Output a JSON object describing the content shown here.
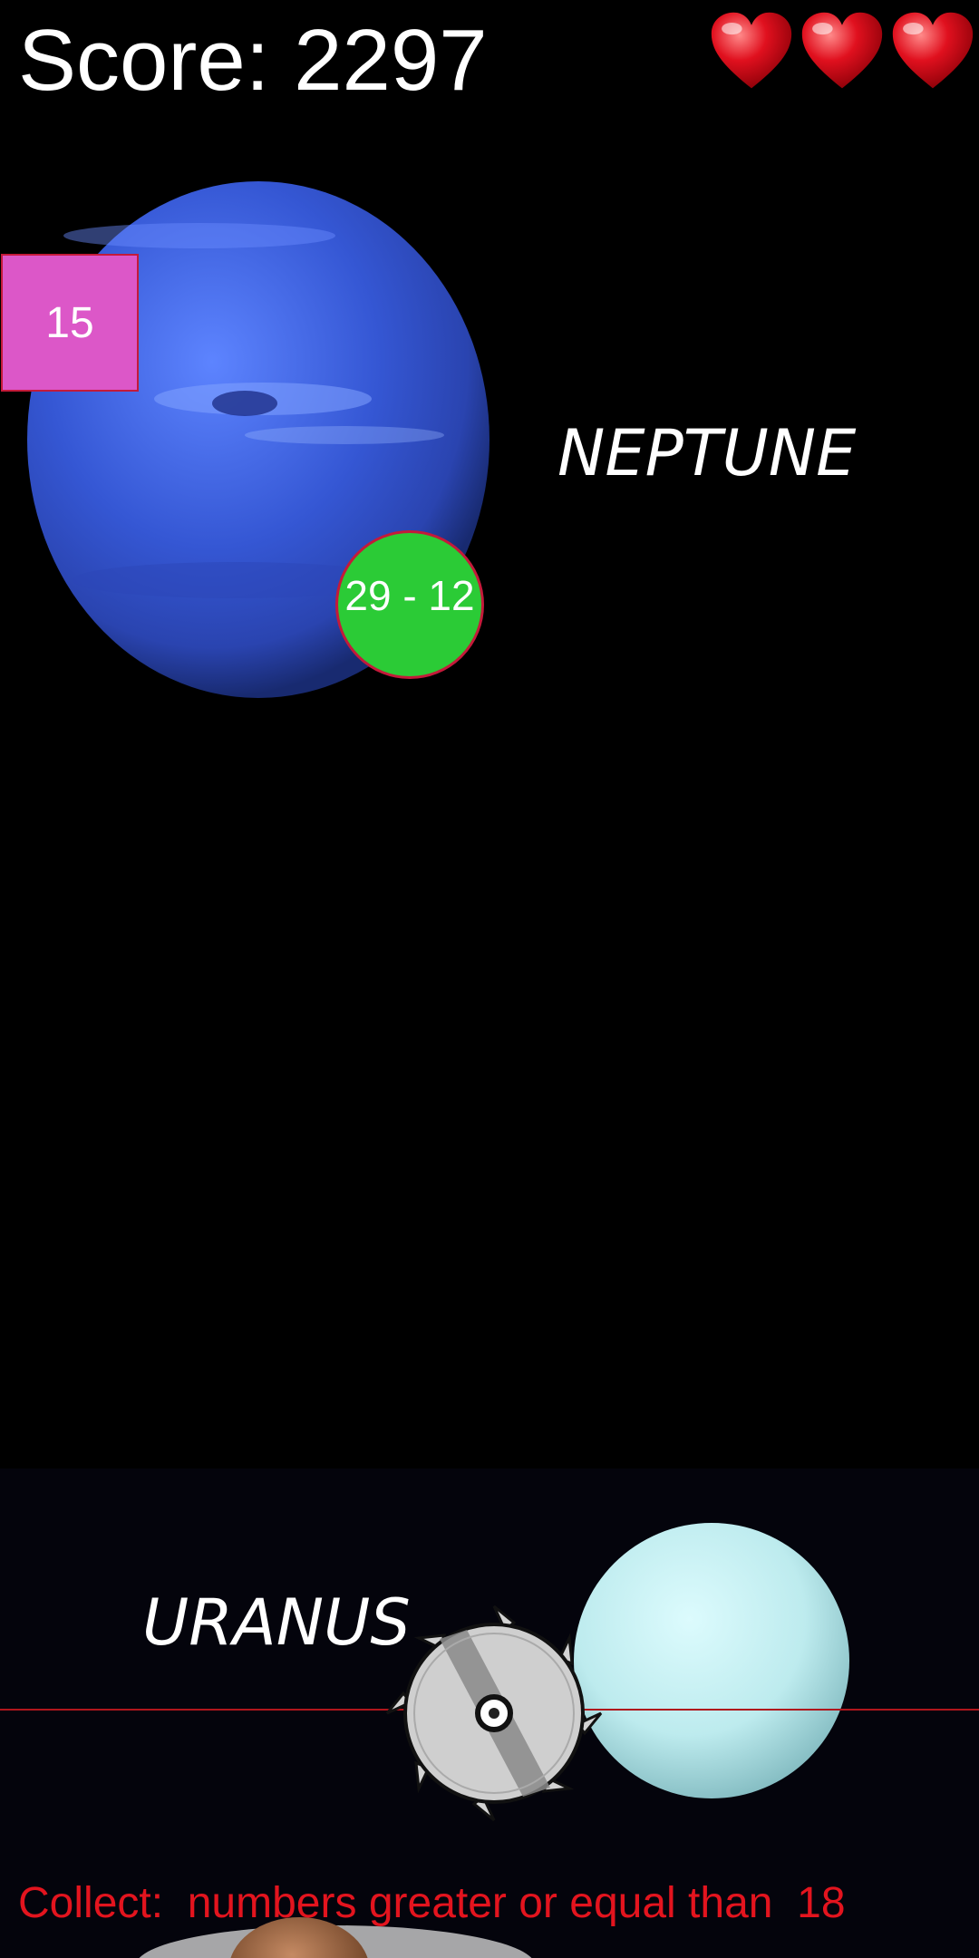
{
  "hud": {
    "score_text": "Score: 2297",
    "lives": 3,
    "heart_icon": "heart-icon",
    "heart_color": "#e0101e"
  },
  "planets": {
    "neptune_label": "NEPTUNE",
    "uranus_label": "URANUS",
    "neptune_color": "#3a5fd6",
    "uranus_color": "#c8f0f2"
  },
  "items": {
    "square_value": "15",
    "square_color": "#dc57c8",
    "circle_value": "29 - 12",
    "circle_color": "#2bcb36"
  },
  "player": {
    "icon": "saw-blade-icon"
  },
  "rule": {
    "text": "Collect:  numbers greater or equal than  18"
  }
}
